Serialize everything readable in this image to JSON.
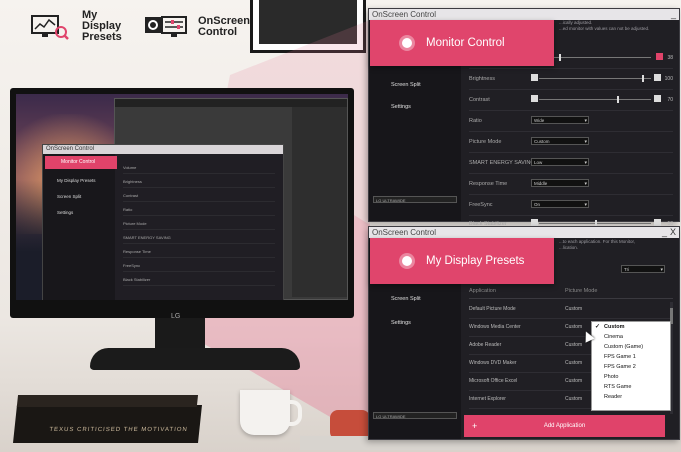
{
  "legend": {
    "presets_line1": "My Display",
    "presets_line2": "Presets",
    "osc_line1": "OnScreen",
    "osc_line2": "Control"
  },
  "monitor": {
    "brand": "LG",
    "mini_window_title": "OnScreen Control",
    "mini_hero": "Monitor Control",
    "mini_items": [
      "My Display Presets",
      "Screen Split",
      "Settings"
    ],
    "mini_rows": [
      "Volume",
      "Brightness",
      "Contrast",
      "Ratio",
      "Picture Mode",
      "SMART ENERGY SAVING",
      "Response Time",
      "FreeSync",
      "Black Stabilizer"
    ],
    "book_text": "TEXUS CRITICISED THE MOTIVATION"
  },
  "window1": {
    "title": "OnScreen Control",
    "min": "_",
    "hero": "Monitor Control",
    "sidebar_items": [
      "Screen Split",
      "Settings"
    ],
    "monitor_select": "LG ULTRAWIDE",
    "notice_line1": "...ically adjusted.",
    "notice_line2": "...ed monitor with values can not be adjusted.",
    "rows": [
      {
        "label": "",
        "value": "38"
      },
      {
        "label": "Brightness",
        "value": "100"
      },
      {
        "label": "Contrast",
        "value": "70"
      },
      {
        "label": "Ratio",
        "dropdown": "Wide"
      },
      {
        "label": "Picture Mode",
        "dropdown": "Custom"
      },
      {
        "label": "SMART ENERGY SAVING",
        "dropdown": "Low"
      },
      {
        "label": "Response Time",
        "dropdown": "Middle"
      },
      {
        "label": "FreeSync",
        "dropdown": "On"
      },
      {
        "label": "Black Stabilizer",
        "value": "50"
      }
    ]
  },
  "window2": {
    "title": "OnScreen Control",
    "min": "_",
    "close": "X",
    "hero": "My Display Presets",
    "sidebar_items": [
      "Screen Split",
      "Settings"
    ],
    "monitor_select": "LG ULTRAWIDE",
    "notice_line1": "...to each application. For this Monitor,",
    "notice_line2": "...lication.",
    "top_dropdown": "Tri",
    "col_application": "Application",
    "col_picture_mode": "Picture Mode",
    "rows": [
      {
        "app": "Default Picture Mode",
        "mode": "Custom"
      },
      {
        "app": "Windows Media Center",
        "mode": "Custom"
      },
      {
        "app": "Adobe Reader",
        "mode": "Custom"
      },
      {
        "app": "Windows DVD Maker",
        "mode": "Custom"
      },
      {
        "app": "Microsoft Office Excel",
        "mode": "Custom"
      },
      {
        "app": "Internet Explorer",
        "mode": "Custom"
      }
    ],
    "menu_options": [
      "Custom",
      "Cinema",
      "Custom (Game)",
      "FPS Game 1",
      "FPS Game 2",
      "Photo",
      "RTS Game",
      "Reader"
    ],
    "menu_selected": "Custom",
    "add_label": "Add Application",
    "add_plus": "+"
  },
  "colors": {
    "accent": "#e0456c",
    "panel": "#201f24",
    "sidebar": "#17161a"
  }
}
